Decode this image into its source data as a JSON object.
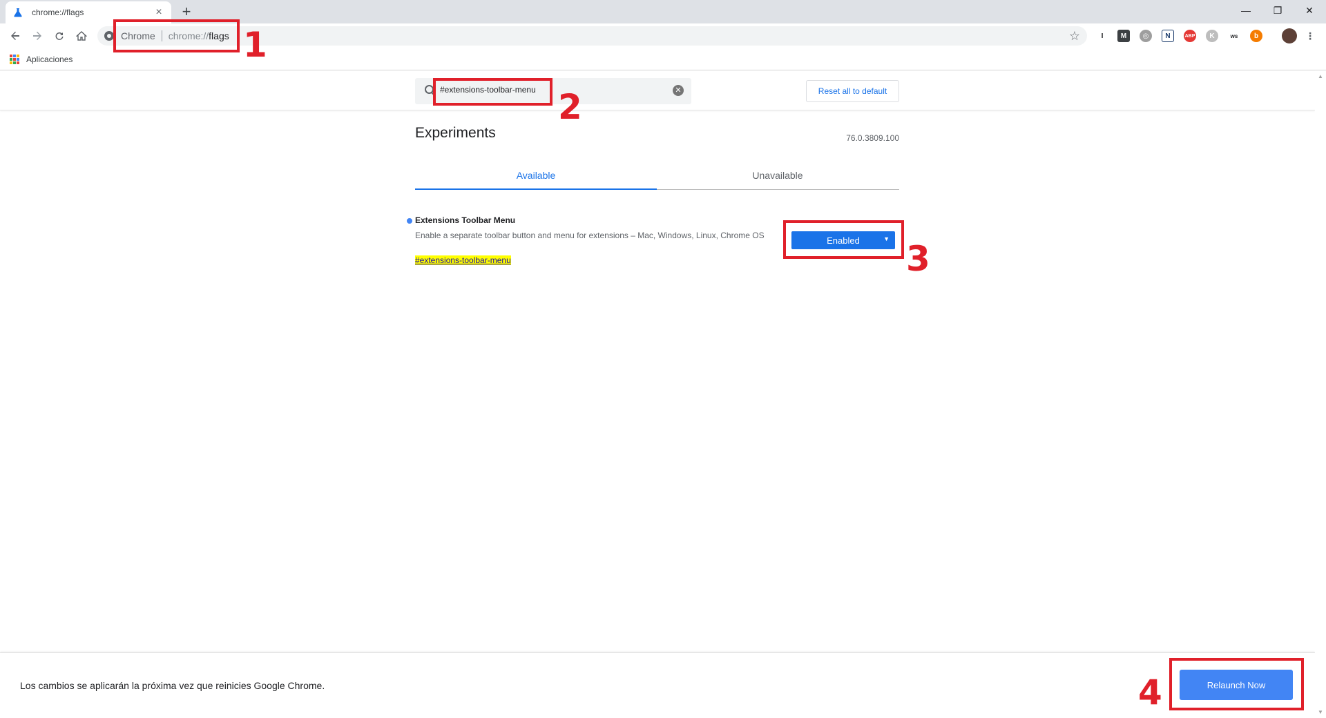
{
  "browser": {
    "tab_title": "chrome://flags",
    "tab_close": "×",
    "new_tab": "+",
    "window_controls": {
      "minimize": "—",
      "restore": "❐",
      "close": "✕"
    },
    "omnibox": {
      "chip": "Chrome",
      "url_scheme": "chrome://",
      "url_path": "flags"
    },
    "bookmarks": {
      "apps_label": "Aplicaciones"
    },
    "extensions": [
      "I",
      "M",
      "◎",
      "N",
      "ABP",
      "K",
      "ws",
      "b"
    ]
  },
  "page": {
    "search": {
      "value": "#extensions-toolbar-menu"
    },
    "reset_button": "Reset all to default",
    "title": "Experiments",
    "version": "76.0.3809.100",
    "tabs": [
      {
        "label": "Available"
      },
      {
        "label": "Unavailable"
      }
    ],
    "flag": {
      "name": "Extensions Toolbar Menu",
      "description": "Enable a separate toolbar button and menu for extensions – Mac, Windows, Linux, Chrome OS",
      "anchor": "#extensions-toolbar-menu",
      "state": "Enabled"
    },
    "footer": {
      "message": "Los cambios se aplicarán la próxima vez que reinicies Google Chrome.",
      "relaunch_button": "Relaunch Now"
    }
  },
  "annotations": [
    "1",
    "2",
    "3",
    "4"
  ],
  "colors": {
    "accent": "#1a73e8",
    "annotation_red": "#e0202a",
    "highlight": "#ffff00"
  }
}
